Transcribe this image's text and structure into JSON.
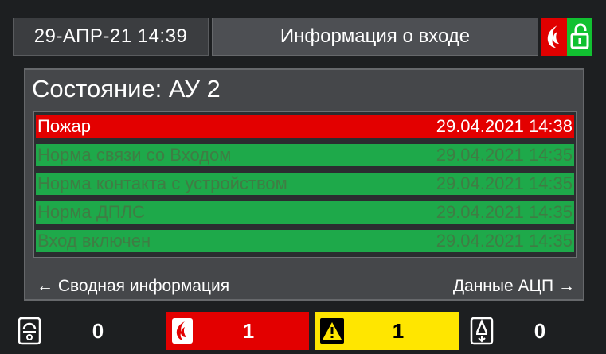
{
  "header": {
    "datetime": "29-АПР-21  14:39",
    "title": "Информация о входе"
  },
  "panel": {
    "state_title": "Состояние: АУ 2",
    "events": [
      {
        "label": "Пожар",
        "time": "29.04.2021 14:38",
        "status": "fire"
      },
      {
        "label": "Норма связи со Входом",
        "time": "29.04.2021 14:35",
        "status": "norm"
      },
      {
        "label": "Норма контакта с устройством",
        "time": "29.04.2021 14:35",
        "status": "norm"
      },
      {
        "label": "Норма ДПЛС",
        "time": "29.04.2021 14:35",
        "status": "norm"
      },
      {
        "label": "Вход включен",
        "time": "29.04.2021 14:35",
        "status": "norm"
      }
    ],
    "nav_left": "← Сводная информация",
    "nav_right": "Данные АЦП →"
  },
  "counters": {
    "devices": "0",
    "fire": "1",
    "warning": "1",
    "disabled": "0"
  },
  "colors": {
    "fire": "#e30000",
    "norm": "#1ea94a",
    "warning": "#ffe600",
    "lock_open": "#11c131"
  }
}
